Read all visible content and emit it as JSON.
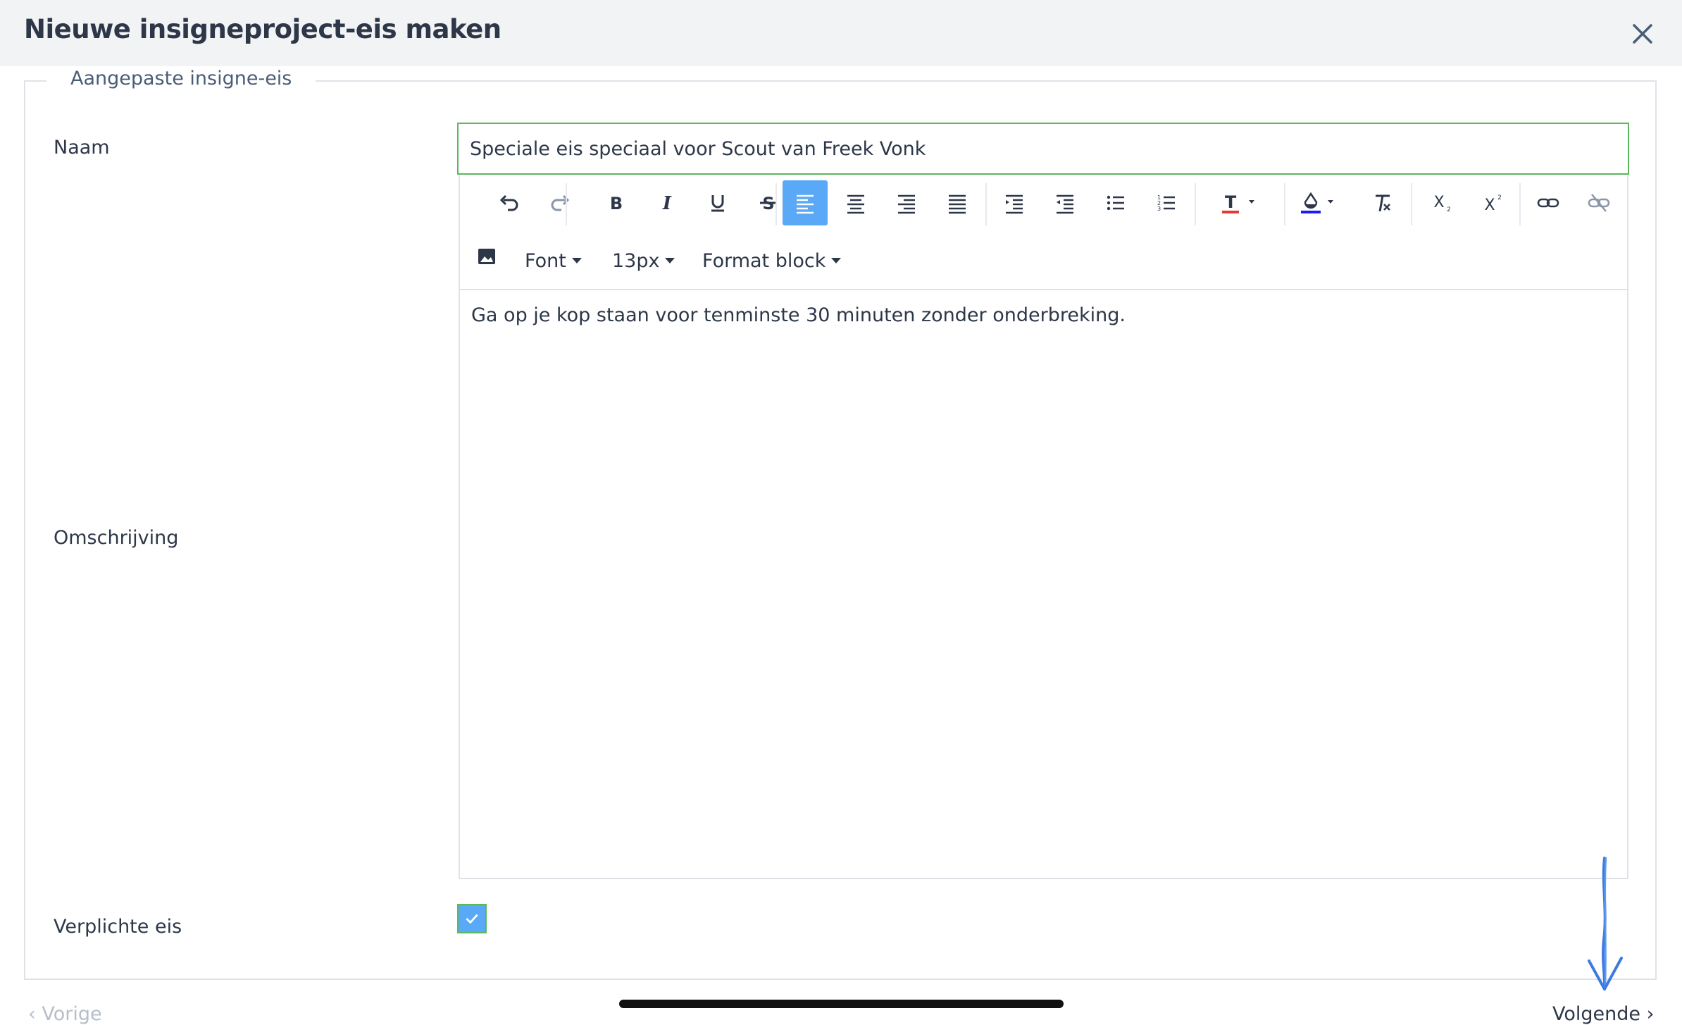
{
  "dialog": {
    "title": "Nieuwe insigneproject-eis maken",
    "close_icon": "close-icon"
  },
  "form": {
    "legend": "Aangepaste insigne-eis",
    "name_label": "Naam",
    "name_value": "Speciale eis speciaal voor Scout van Freek Vonk",
    "description_label": "Omschrijving",
    "description_text": "Ga op je kop staan voor tenminste 30 minuten zonder onderbreking.",
    "required_label": "Verplichte eis",
    "required_checked": true
  },
  "toolbar": {
    "font_label": "Font",
    "size_label": "13px",
    "format_label": "Format block",
    "text_color": "#e53935",
    "highlight_color": "#1a1aff",
    "active_color": "#5aa9f6"
  },
  "footer": {
    "prev_label": "Vorige",
    "next_label": "Volgende"
  }
}
